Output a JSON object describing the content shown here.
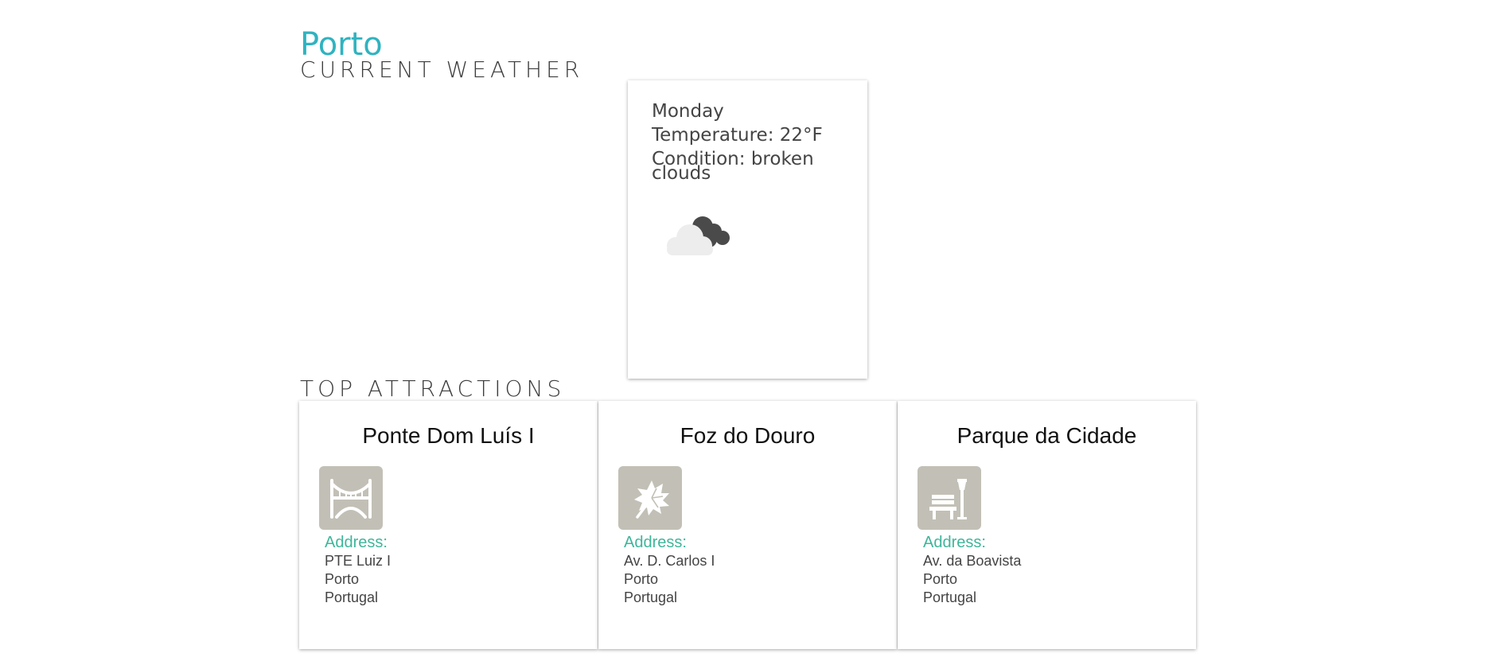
{
  "city": {
    "name": "Porto"
  },
  "sections": {
    "current_weather": "CURRENT WEATHER",
    "top_attractions": "TOP ATTRACTIONS"
  },
  "weather": {
    "day": "Monday",
    "temperature": "Temperature: 22°F",
    "condition_line1": "Condition: broken",
    "condition_line2": "clouds",
    "icon": "broken-clouds-icon"
  },
  "attractions": [
    {
      "name": "Ponte Dom Luís I",
      "icon": "bridge-icon",
      "address_label": "Address:",
      "address": [
        "PTE Luiz I",
        "Porto",
        "Portugal"
      ]
    },
    {
      "name": "Foz do Douro",
      "icon": "leaf-icon",
      "address_label": "Address:",
      "address": [
        "Av. D. Carlos I",
        "Porto",
        "Portugal"
      ]
    },
    {
      "name": "Parque da Cidade",
      "icon": "park-bench-icon",
      "address_label": "Address:",
      "address": [
        "Av. da Boavista",
        "Porto",
        "Portugal"
      ]
    }
  ],
  "colors": {
    "accent": "#2fb3c0",
    "address_label": "#3fb59a",
    "icon_tile": "#c2c0b6"
  }
}
